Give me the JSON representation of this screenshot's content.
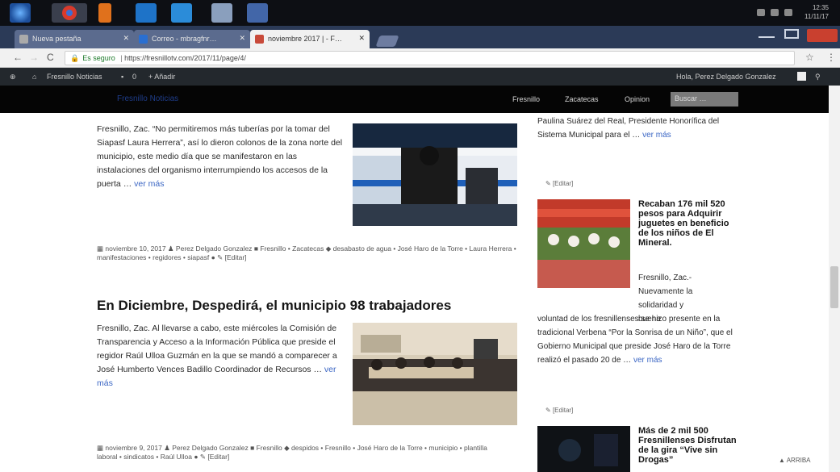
{
  "taskbar": {
    "clock_time": "12:35",
    "clock_date": "11/11/17"
  },
  "tabs": [
    {
      "label": "Nueva pestaña"
    },
    {
      "label": "Correo - mbragfnr…"
    },
    {
      "label": "noviembre 2017 | - F…"
    }
  ],
  "address": {
    "secure_label": "Es seguro",
    "url": "https://fresnillotv.com/2017/11/page/4/"
  },
  "adminbar": {
    "site_label": "Fresnillo Noticias",
    "comments_count": "0",
    "new_label": "+ Añadir",
    "greeting": "Hola, Perez Delgado Gonzalez"
  },
  "sitenav": {
    "brand": "Fresnillo Noticias",
    "menu": [
      "Fresnillo",
      "Zacatecas",
      "Opinion"
    ],
    "search_placeholder": "Buscar …"
  },
  "posts": [
    {
      "excerpt": "Fresnillo, Zac. “No permitiremos más tuberías por la tomar del Siapasf Laura Herrera”, así lo dieron colonos de la zona norte del municipio, este medio día que se manifestaron en las instalaciones del organismo interrumpiendo los accesos de la puerta …",
      "more": "ver más",
      "date": "noviembre 10, 2017",
      "author": "Perez Delgado Gonzalez",
      "categories": "Fresnillo • Zacatecas",
      "tags": "desabasto de agua • José Haro de la Torre • Laura Herrera • manifestaciones • regidores • siapasf",
      "edit": "[Editar]"
    },
    {
      "title": "En Diciembre, Despedirá, el municipio 98 trabajadores",
      "excerpt": "Fresnillo, Zac. Al llevarse a cabo, este miércoles la Comisión de Transparencia y Acceso a la Información Pública que preside el regidor Raúl Ulloa Guzmán en la que se mandó a comparecer a José Humberto Vences Badillo Coordinador de Recursos …",
      "more": "ver más",
      "date": "noviembre 9, 2017",
      "author": "Perez Delgado Gonzalez",
      "categories": "Fresnillo",
      "tags": "despidos • Fresnillo • José Haro de la Torre • municipio • plantilla laboral • sindicatos • Raúl Ulloa",
      "edit": "[Editar]"
    }
  ],
  "sidebar": {
    "top_text": "Paulina Suárez del Real, Presidente Honorífica del Sistema Municipal para el …",
    "top_more": "ver más",
    "edit1": "[Editar]",
    "story1_title": "Recaban 176 mil 520 pesos para Adquirir juguetes en beneficio de los niños de El Mineral.",
    "story1_text_col": "Fresnillo, Zac.- Nuevamente la solidaridad y buena",
    "story1_text_full": "voluntad de los fresnillenses se hizo presente en la tradicional Verbena “Por la Sonrisa de un Niño”, que el Gobierno Municipal que preside José Haro de la Torre realizó el pasado 20 de …",
    "story1_more": "ver más",
    "edit2": "[Editar]",
    "story2_title": "Más de 2 mil 500 Fresnillenses Disfrutan de la gira “Vive sin Drogas”"
  },
  "back_to_top": "▲ ARRIBA",
  "colors": {
    "link": "#3b66c4",
    "nav_bg": "#050505",
    "adminbar_bg": "#23282d"
  }
}
